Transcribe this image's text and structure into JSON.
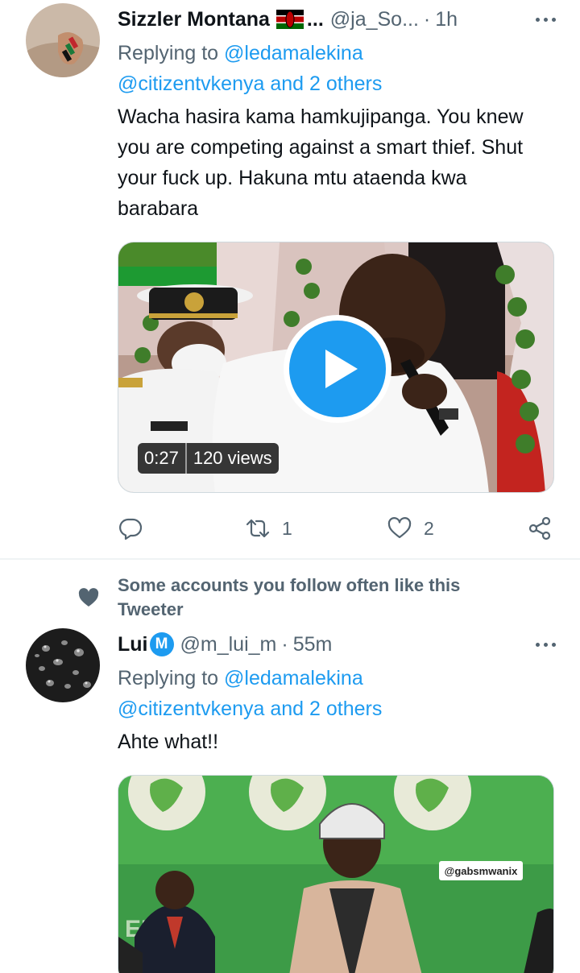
{
  "tweets": [
    {
      "display_name": "Sizzler Montana",
      "name_suffix": "...",
      "handle": "@ja_So...",
      "dot": "·",
      "time": "1h",
      "replying_prefix": "Replying to",
      "replying_to_1": "@ledamalekina",
      "replying_to_2": "@citizentvkenya and 2 others",
      "text": "Wacha hasira kama hamkujipanga. You knew you are competing against a smart thief. Shut your fuck up. Hakuna mtu ataenda kwa barabara",
      "video": {
        "duration": "0:27",
        "views": "120 views"
      },
      "stats": {
        "retweets": "1",
        "likes": "2"
      }
    },
    {
      "social_context": "Some accounts you follow often like this Tweeter",
      "display_name": "Lui",
      "verified_glyph": "M",
      "handle": "@m_lui_m",
      "dot": "·",
      "time": "55m",
      "replying_prefix": "Replying to",
      "replying_to_1": "@ledamalekina",
      "replying_to_2": "@citizentvkenya and 2 others",
      "text": "Ahte what!!",
      "watermark": "@gabsmwanix",
      "banner_text": "EBC"
    }
  ],
  "icons": {
    "reply": "reply-icon",
    "retweet": "retweet-icon",
    "like": "heart-icon",
    "share": "share-icon",
    "more": "more-icon",
    "social": "heart-icon",
    "flag": "kenya-flag-icon"
  },
  "colors": {
    "accent": "#1d9bf0",
    "secondary_text": "#536471",
    "primary_text": "#0f1419"
  }
}
